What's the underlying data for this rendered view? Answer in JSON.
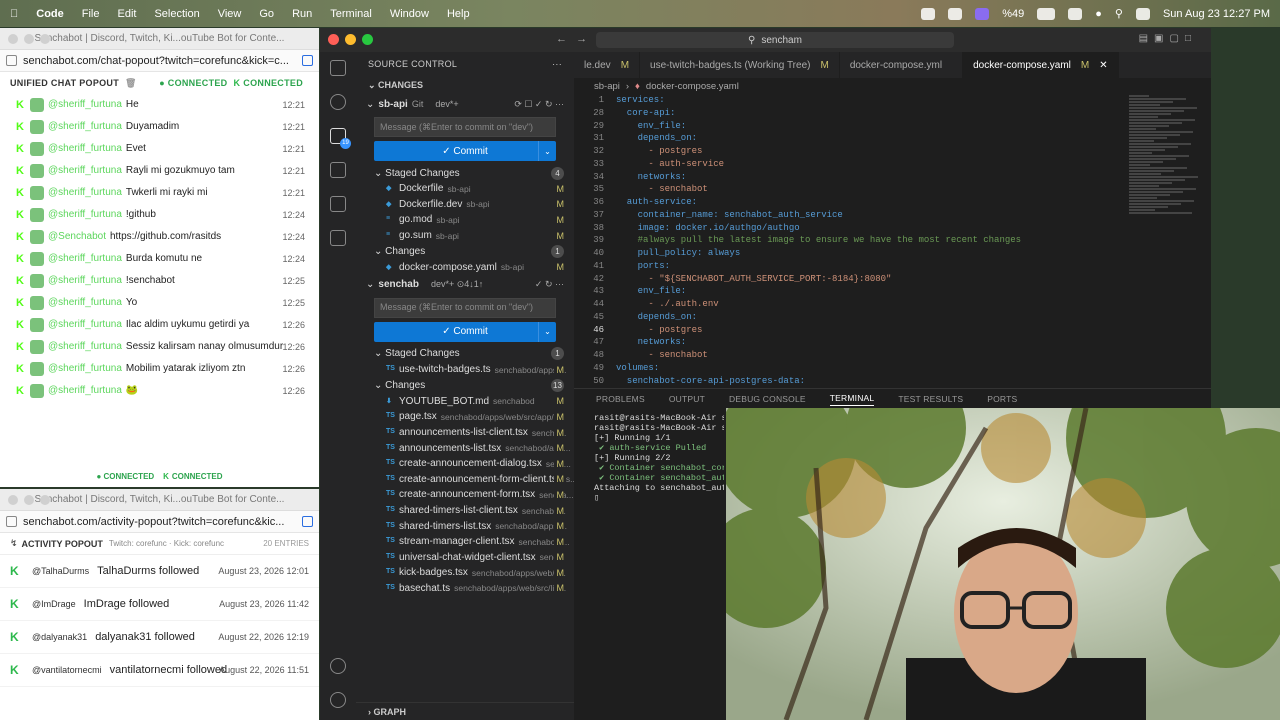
{
  "menubar": {
    "app": "Code",
    "items": [
      "File",
      "Edit",
      "Selection",
      "View",
      "Go",
      "Run",
      "Terminal",
      "Window",
      "Help"
    ],
    "battery": "%49",
    "datetime": "Sun Aug 23  12:27 PM"
  },
  "chatwin": {
    "title": "Senchabot | Discord, Twitch, Ki...ouTube Bot for Conte...",
    "url": "senchabot.com/chat-popout?twitch=corefunc&kick=c...",
    "header": "UNIFIED CHAT POPOUT",
    "conn1": "CONNECTED",
    "conn2": "CONNECTED",
    "messages": [
      {
        "user": "@sheriff_furtuna",
        "msg": "He",
        "time": "12:21"
      },
      {
        "user": "@sheriff_furtuna",
        "msg": "Duyamadim",
        "time": "12:21"
      },
      {
        "user": "@sheriff_furtuna",
        "msg": "Evet",
        "time": "12:21"
      },
      {
        "user": "@sheriff_furtuna",
        "msg": "Rayli mi gozukmuyo tam",
        "time": "12:21"
      },
      {
        "user": "@sheriff_furtuna",
        "msg": "Twkerli mi rayki mi",
        "time": "12:21"
      },
      {
        "user": "@sheriff_furtuna",
        "msg": "!github",
        "time": "12:24"
      },
      {
        "user": "@Senchabot",
        "msg": "https://github.com/rasitds",
        "time": "12:24"
      },
      {
        "user": "@sheriff_furtuna",
        "msg": "Burda komutu ne",
        "time": "12:24"
      },
      {
        "user": "@sheriff_furtuna",
        "msg": "!senchabot",
        "time": "12:25"
      },
      {
        "user": "@sheriff_furtuna",
        "msg": "Yo",
        "time": "12:25"
      },
      {
        "user": "@sheriff_furtuna",
        "msg": "Ilac aldim uykumu getirdi ya",
        "time": "12:26"
      },
      {
        "user": "@sheriff_furtuna",
        "msg": "Sessiz kalirsam nanay olmusumdur",
        "time": "12:26"
      },
      {
        "user": "@sheriff_furtuna",
        "msg": "Mobilim yatarak izliyom ztn",
        "time": "12:26"
      },
      {
        "user": "@sheriff_furtuna",
        "msg": "🐸",
        "time": "12:26"
      }
    ],
    "foot1": "CONNECTED",
    "foot2": "CONNECTED"
  },
  "actwin": {
    "title": "Senchabot | Discord, Twitch, Ki...ouTube Bot for Conte...",
    "url": "senchabot.com/activity-popout?twitch=corefunc&kic...",
    "header": "ACTIVITY POPOUT",
    "sub": "Twitch: corefunc · Kick: corefunc",
    "count": "20 ENTRIES",
    "rows": [
      {
        "handle": "@TalhaDurms",
        "text": "TalhaDurms followed",
        "date": "August 23, 2026 12:01"
      },
      {
        "handle": "@ImDrage",
        "text": "ImDrage followed",
        "date": "August 23, 2026 11:42"
      },
      {
        "handle": "@dalyanak31",
        "text": "dalyanak31 followed",
        "date": "August 22, 2026 12:19"
      },
      {
        "handle": "@vantilatornecmi",
        "text": "vantilatornecmi followed",
        "date": "August 22, 2026 11:51"
      }
    ]
  },
  "vscode": {
    "search": "sencham",
    "sidebar_title": "SOURCE CONTROL",
    "changes_label": "CHANGES",
    "repo1": {
      "name": "sb-api",
      "type": "Git",
      "branch": "dev*+",
      "placeholder": "Message (⌘Enter to commit on \"dev\")",
      "commit": "✓ Commit",
      "staged_label": "Staged Changes",
      "staged_count": "4",
      "staged": [
        {
          "name": "Dockerfile",
          "path": "sb-api",
          "st": "M"
        },
        {
          "name": "Dockerfile.dev",
          "path": "sb-api",
          "st": "M"
        },
        {
          "name": "go.mod",
          "path": "sb-api",
          "st": "M"
        },
        {
          "name": "go.sum",
          "path": "sb-api",
          "st": "M"
        }
      ],
      "changes_label": "Changes",
      "changes_count": "1",
      "changes": [
        {
          "name": "docker-compose.yaml",
          "path": "sb-api",
          "st": "M"
        }
      ]
    },
    "repo2": {
      "name": "senchab",
      "branch": "dev*+ ⊙4↓1↑",
      "placeholder": "Message (⌘Enter to commit on \"dev\")",
      "commit": "✓ Commit",
      "staged_label": "Staged Changes",
      "staged_count": "1",
      "staged": [
        {
          "name": "use-twitch-badges.ts",
          "path": "senchabod/apps/...",
          "st": "M"
        }
      ],
      "changes_label": "Changes",
      "changes_count": "13",
      "changes": [
        {
          "name": "YOUTUBE_BOT.md",
          "path": "senchabod",
          "st": "M"
        },
        {
          "name": "page.tsx",
          "path": "senchabod/apps/web/src/app/(...",
          "st": "M"
        },
        {
          "name": "announcements-list-client.tsx",
          "path": "sencha...",
          "st": "M"
        },
        {
          "name": "announcements-list.tsx",
          "path": "senchabod/app...",
          "st": "M"
        },
        {
          "name": "create-announcement-dialog.tsx",
          "path": "senc...",
          "st": "M"
        },
        {
          "name": "create-announcement-form-client.tsx",
          "path": "s...",
          "st": "M"
        },
        {
          "name": "create-announcement-form.tsx",
          "path": "sencha...",
          "st": "M"
        },
        {
          "name": "shared-timers-list-client.tsx",
          "path": "senchabo...",
          "st": "M"
        },
        {
          "name": "shared-timers-list.tsx",
          "path": "senchabod/apps/...",
          "st": "M"
        },
        {
          "name": "stream-manager-client.tsx",
          "path": "senchabod/...",
          "st": "M"
        },
        {
          "name": "universal-chat-widget-client.tsx",
          "path": "senc...",
          "st": "M"
        },
        {
          "name": "kick-badges.tsx",
          "path": "senchabod/apps/web/s...",
          "st": "M"
        },
        {
          "name": "basechat.ts",
          "path": "senchabod/apps/web/src/lib...",
          "st": "M"
        }
      ]
    },
    "graph": "GRAPH",
    "tabs": [
      {
        "label": "le.dev",
        "m": "M"
      },
      {
        "label": "use-twitch-badges.ts (Working Tree)",
        "m": "M"
      },
      {
        "label": "docker-compose.yml",
        "m": ""
      },
      {
        "label": "docker-compose.yaml",
        "m": "M"
      }
    ],
    "crumb1": "sb-api",
    "crumb2": "docker-compose.yaml",
    "code": [
      {
        "n": "1",
        "t": "services:"
      },
      {
        "n": "28",
        "t": "  core-api:"
      },
      {
        "n": "29",
        "t": "    env_file:"
      },
      {
        "n": "31",
        "t": "    depends_on:"
      },
      {
        "n": "32",
        "t": "      - postgres"
      },
      {
        "n": "33",
        "t": "      - auth-service"
      },
      {
        "n": "34",
        "t": "    networks:"
      },
      {
        "n": "35",
        "t": "      - senchabot"
      },
      {
        "n": "36",
        "t": "  auth-service:"
      },
      {
        "n": "37",
        "t": "    container_name: senchabot_auth_service"
      },
      {
        "n": "38",
        "t": "    image: docker.io/authgo/authgo"
      },
      {
        "n": "39",
        "t": "    #always pull the latest image to ensure we have the most recent changes"
      },
      {
        "n": "40",
        "t": "    pull_policy: always"
      },
      {
        "n": "41",
        "t": "    ports:"
      },
      {
        "n": "42",
        "t": "      - \"${SENCHABOT_AUTH_SERVICE_PORT:-8184}:8080\""
      },
      {
        "n": "43",
        "t": "    env_file:"
      },
      {
        "n": "44",
        "t": "      - ./.auth.env"
      },
      {
        "n": "45",
        "t": "    depends_on:"
      },
      {
        "n": "46",
        "t": "      - postgres"
      },
      {
        "n": "47",
        "t": "    networks:"
      },
      {
        "n": "48",
        "t": "      - senchabot"
      },
      {
        "n": "49",
        "t": "volumes:"
      },
      {
        "n": "50",
        "t": "  senchabot-core-api-postgres-data:"
      }
    ],
    "panel_tabs": [
      "PROBLEMS",
      "OUTPUT",
      "DEBUG CONSOLE",
      "TERMINAL",
      "TEST RESULTS",
      "PORTS"
    ],
    "terminal": [
      "rasit@rasits-MacBook-Air s",
      "rasit@rasits-MacBook-Air s",
      "[+] Running 1/1",
      " ✔ auth-service Pulled",
      "[+] Running 2/2",
      " ✔ Container senchabot_cor",
      " ✔ Container senchabot_aut",
      "Attaching to senchabot_aut",
      "▯"
    ]
  }
}
